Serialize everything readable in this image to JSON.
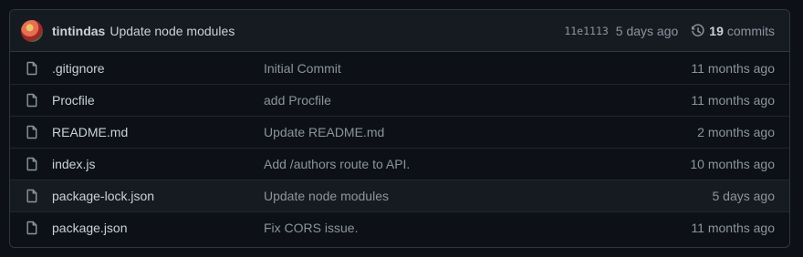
{
  "latest_commit": {
    "author": "tintindas",
    "message": "Update node modules",
    "sha": "11e1113",
    "time_ago": "5 days ago",
    "commit_count": "19",
    "commits_label": "commits"
  },
  "files": [
    {
      "icon": "file-icon",
      "name": ".gitignore",
      "message": "Initial Commit",
      "age": "11 months ago"
    },
    {
      "icon": "file-icon",
      "name": "Procfile",
      "message": "add Procfile",
      "age": "11 months ago"
    },
    {
      "icon": "file-icon",
      "name": "README.md",
      "message": "Update README.md",
      "age": "2 months ago"
    },
    {
      "icon": "file-icon",
      "name": "index.js",
      "message": "Add /authors route to API.",
      "age": "10 months ago"
    },
    {
      "icon": "file-icon",
      "name": "package-lock.json",
      "message": "Update node modules",
      "age": "5 days ago",
      "highlighted": true
    },
    {
      "icon": "file-icon",
      "name": "package.json",
      "message": "Fix CORS issue.",
      "age": "11 months ago"
    }
  ],
  "colors": {
    "background": "#0d1117",
    "header_bg": "#161b22",
    "border": "#30363d",
    "text": "#c9d1d9",
    "muted": "#8b949e"
  }
}
